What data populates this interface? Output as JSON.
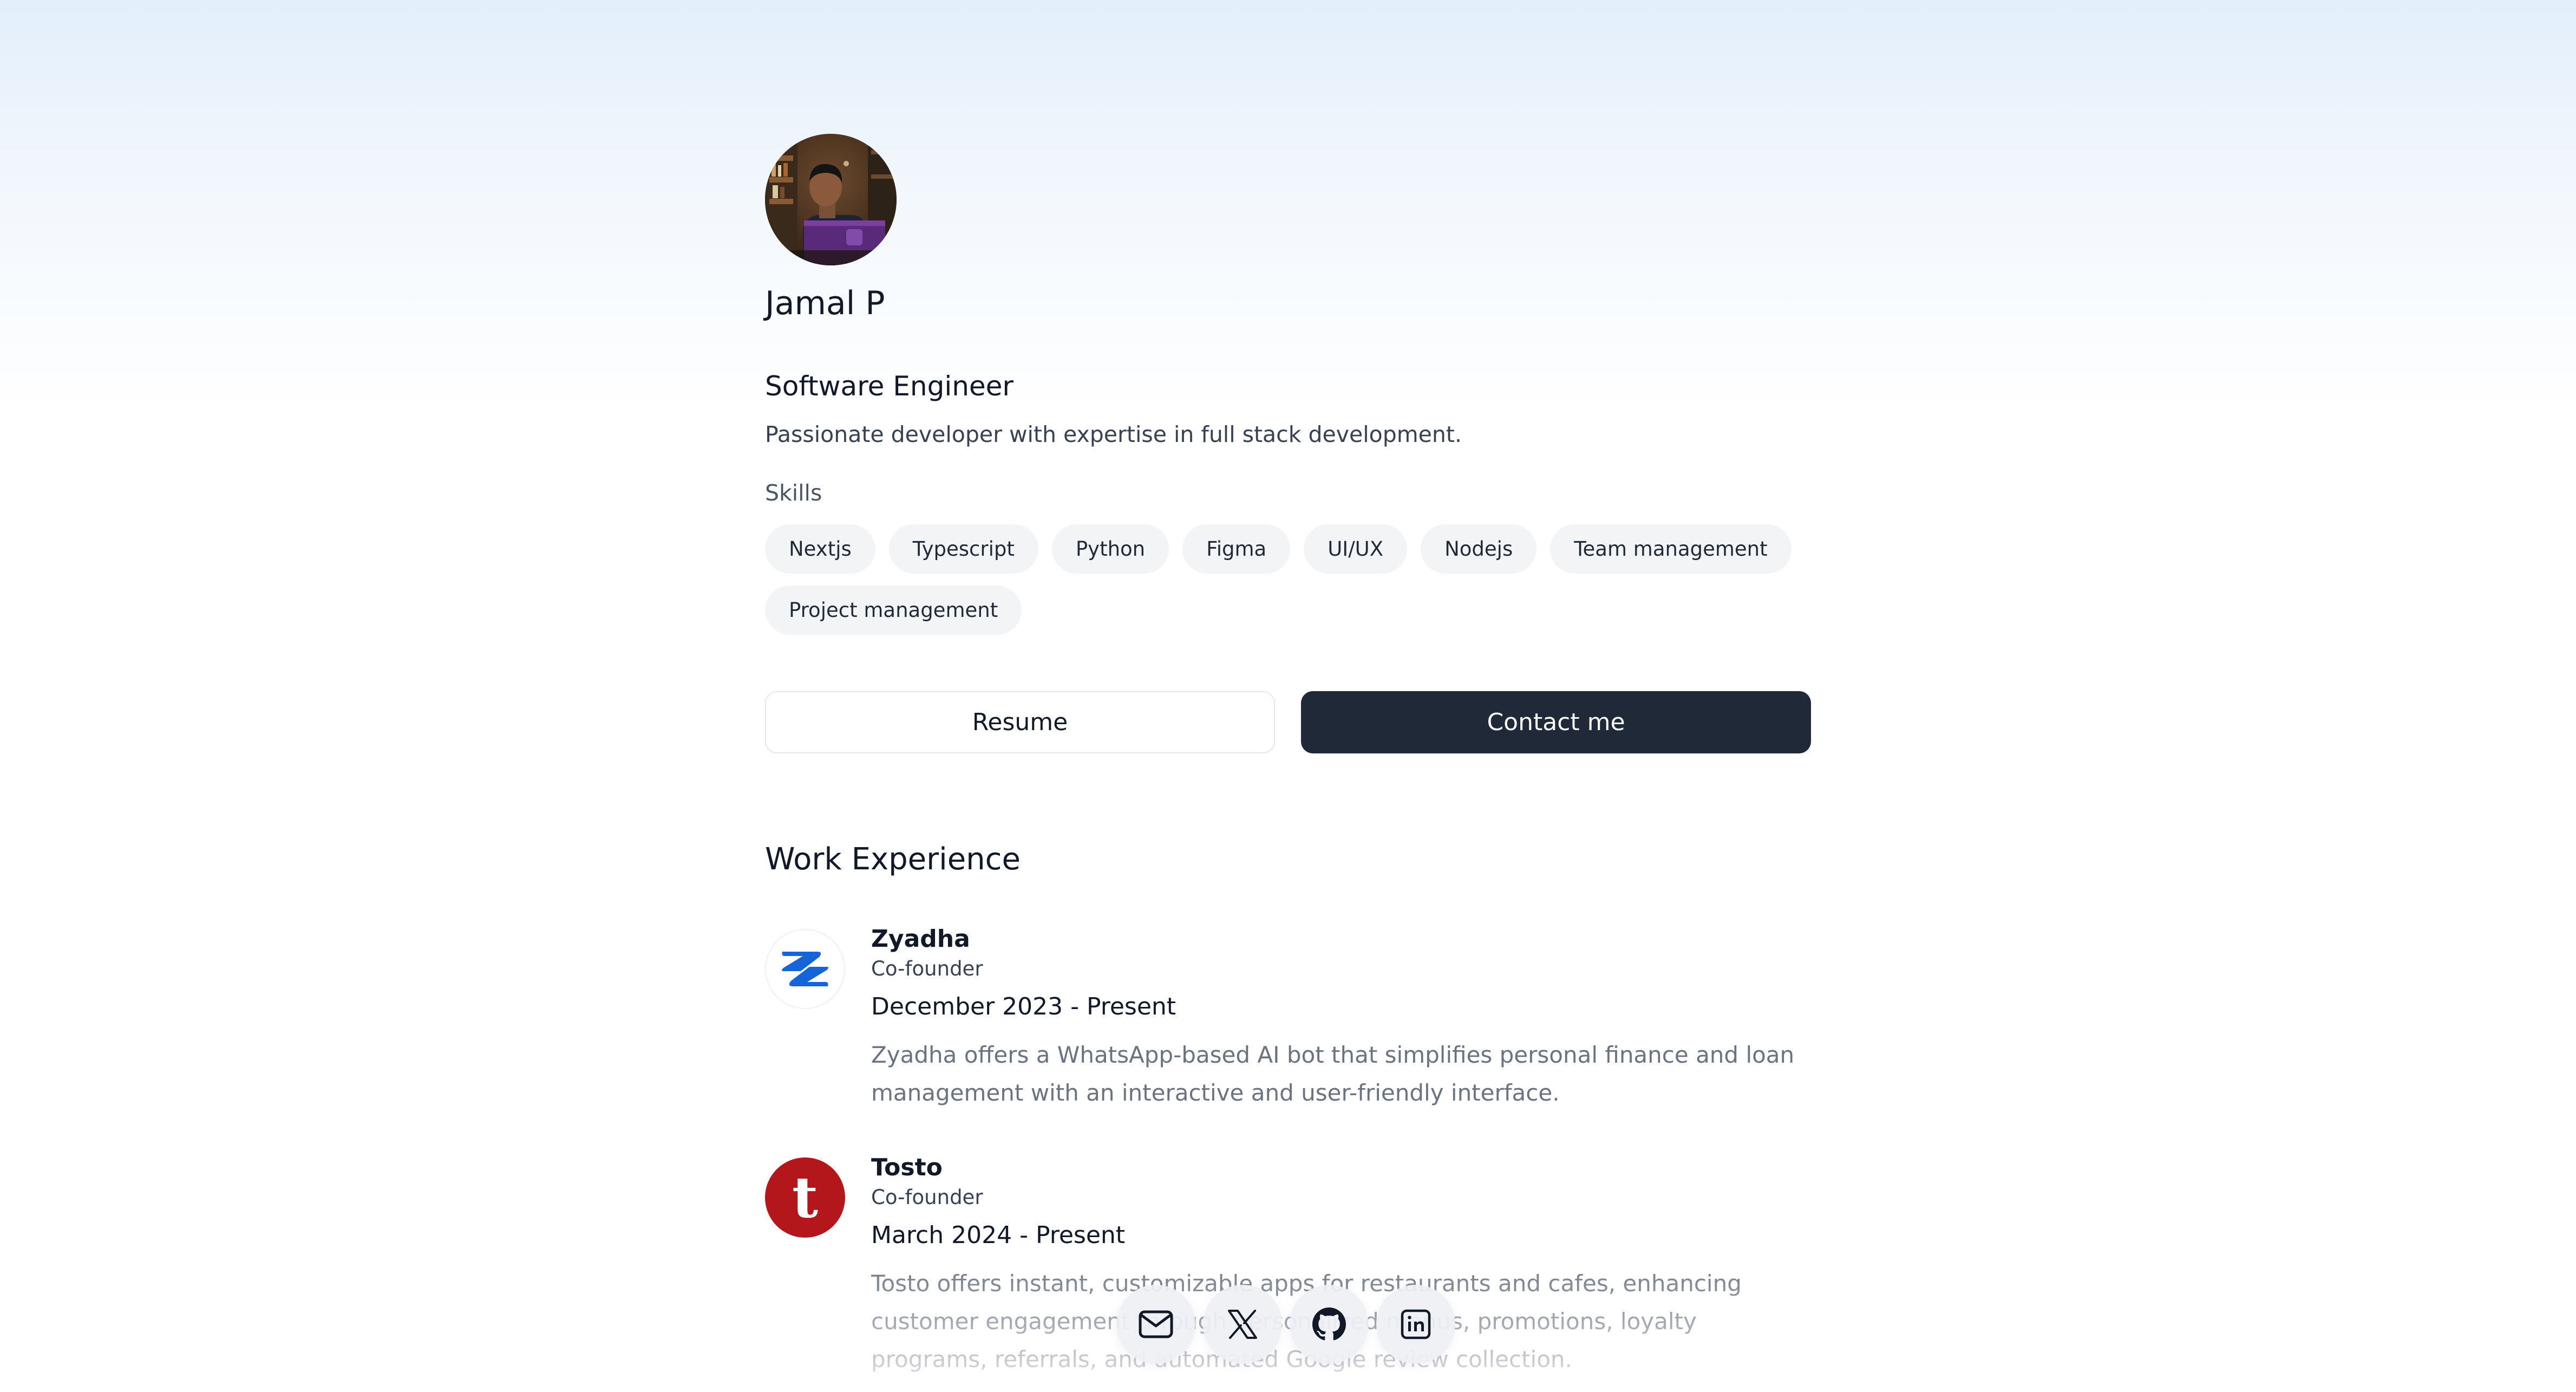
{
  "profile": {
    "avatar_alt": "Jamal P",
    "name": "Jamal P",
    "title": "Software Engineer",
    "bio": "Passionate developer with expertise in full stack development."
  },
  "skills": {
    "heading": "Skills",
    "items": [
      "Nextjs",
      "Typescript",
      "Python",
      "Figma",
      "UI/UX",
      "Nodejs",
      "Team management",
      "Project management"
    ]
  },
  "actions": {
    "resume_label": "Resume",
    "contact_label": "Contact me"
  },
  "work": {
    "heading": "Work Experience",
    "jobs": [
      {
        "company": "Zyadha",
        "role": "Co-founder",
        "period": "December 2023 - Present",
        "description": "Zyadha offers a WhatsApp-based AI bot that simplifies personal finance and loan management with an interactive and user-friendly interface.",
        "logo_icon": "zyadha-logo",
        "logo_color": "#1565d8"
      },
      {
        "company": "Tosto",
        "role": "Co-founder",
        "period": "March 2024 - Present",
        "description": "Tosto offers instant, customizable apps for restaurants and cafes, enhancing customer engagement through personalized menus, promotions, loyalty programs, referrals, and automated Google review collection.",
        "logo_icon": "tosto-logo",
        "logo_letter": "t",
        "logo_color": "#b3161b"
      }
    ]
  },
  "dock": {
    "items": [
      {
        "icon": "mail-icon",
        "label": "Email"
      },
      {
        "icon": "x-icon",
        "label": "X"
      },
      {
        "icon": "github-icon",
        "label": "GitHub"
      },
      {
        "icon": "linkedin-icon",
        "label": "LinkedIn"
      }
    ]
  },
  "colors": {
    "primary_button": "#1f2937",
    "background_top": "#e3effb",
    "skill_chip": "#f3f4f6"
  }
}
